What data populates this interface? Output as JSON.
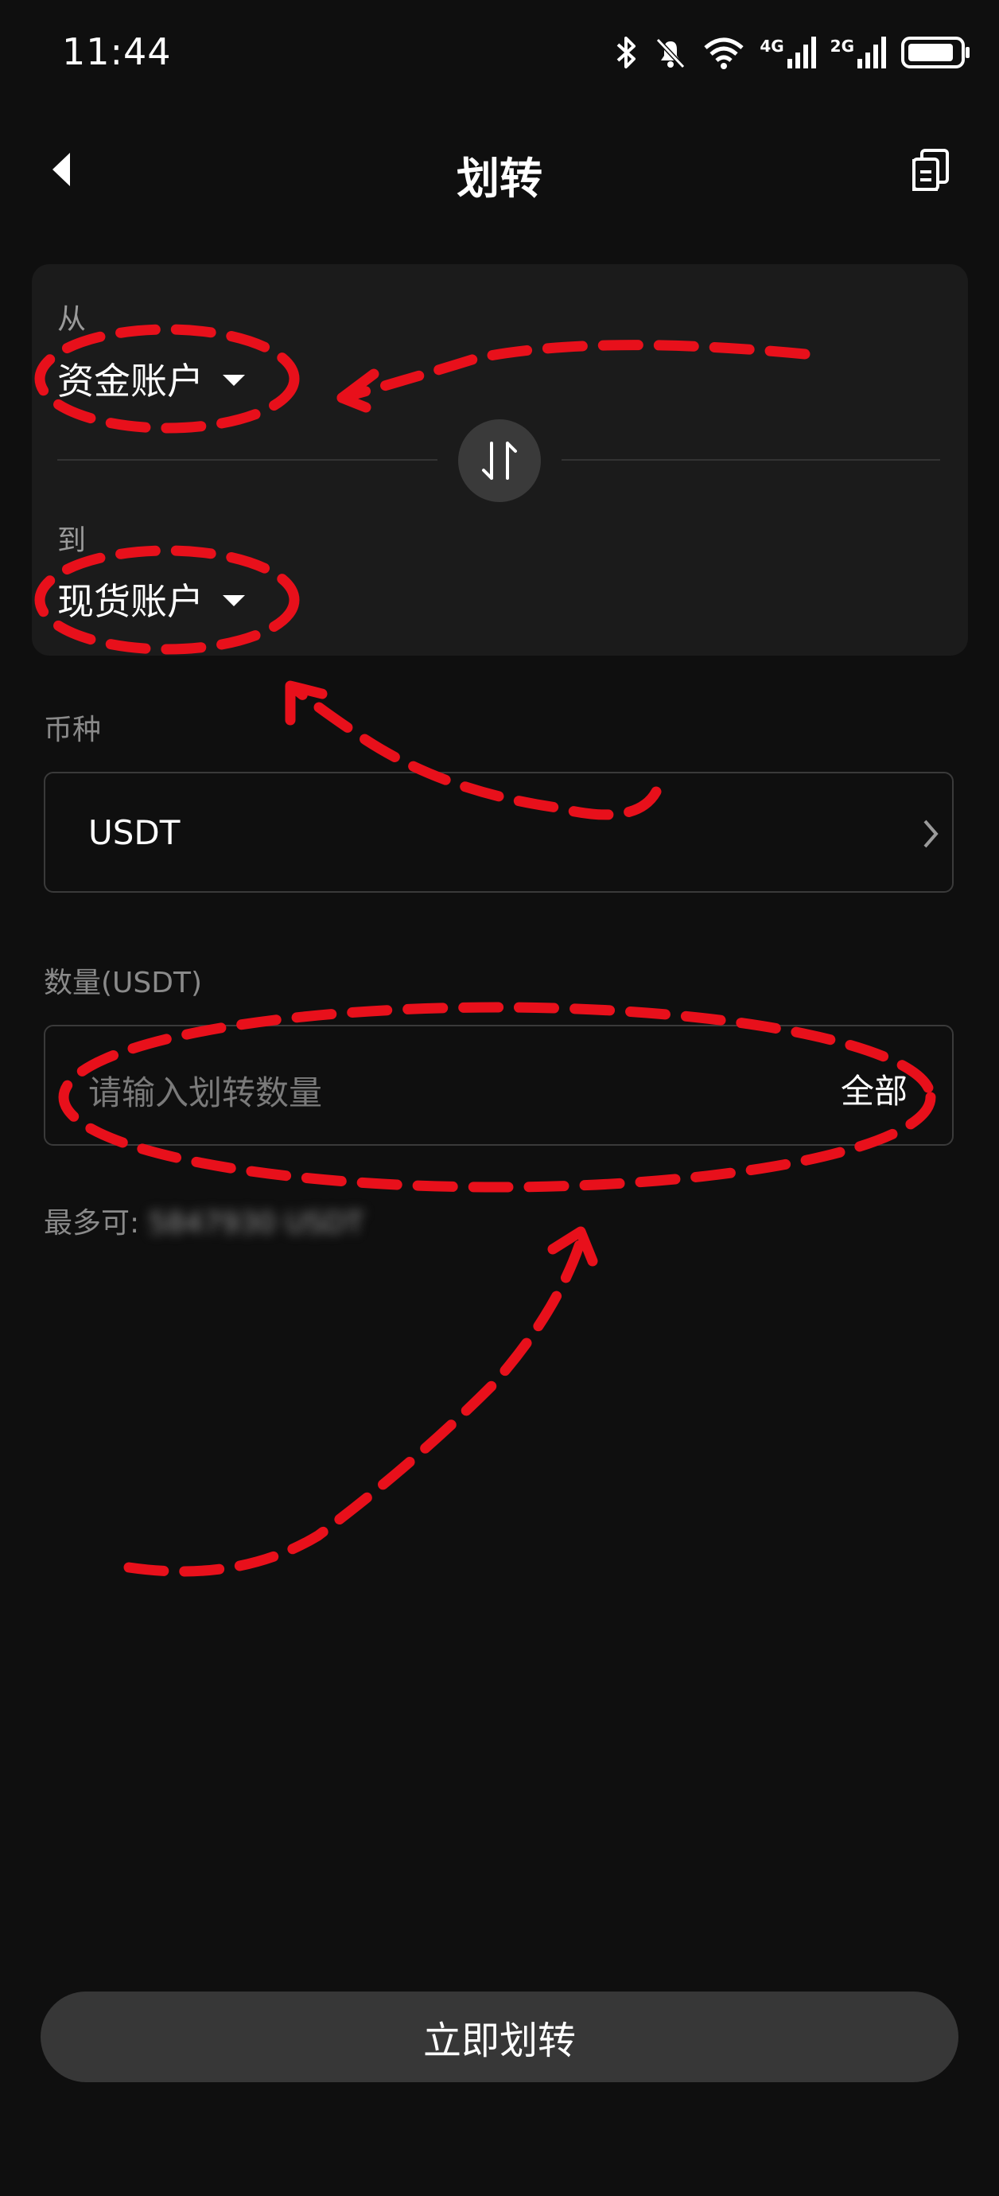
{
  "status_bar": {
    "time": "11:44",
    "network_1": "4G",
    "network_2": "2G"
  },
  "nav": {
    "title": "划转",
    "back_icon": "back-arrow-icon",
    "record_icon": "record-document-icon"
  },
  "transfer": {
    "from_label": "从",
    "from_account": "资金账户",
    "to_label": "到",
    "to_account": "现货账户",
    "swap_icon": "swap-arrows-icon"
  },
  "coin": {
    "label": "币种",
    "value": "USDT"
  },
  "amount": {
    "label": "数量(USDT)",
    "placeholder": "请输入划转数量",
    "all_label": "全部",
    "max_label": "最多可:",
    "max_value": "5847930 USDT"
  },
  "submit_label": "立即划转",
  "colors": {
    "background": "#0f0f0f",
    "card": "#1b1b1b",
    "button": "#373737",
    "annotation": "#e8101b"
  }
}
